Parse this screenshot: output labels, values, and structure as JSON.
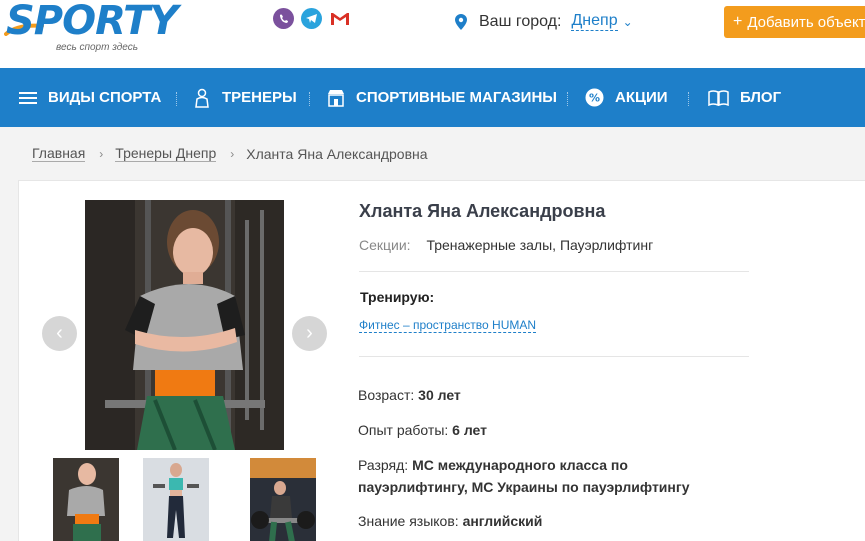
{
  "header": {
    "logo_text": "SPORTY",
    "logo_tagline": "весь спорт здесь",
    "social": [
      {
        "name": "viber-icon"
      },
      {
        "name": "telegram-icon"
      },
      {
        "name": "gmail-icon"
      }
    ],
    "city_label": "Ваш город:",
    "city_value": "Днепр",
    "add_button_label": "Добавить объект"
  },
  "nav": {
    "items": [
      {
        "label": "ВИДЫ СПОРТА",
        "icon": "menu-icon"
      },
      {
        "label": "ТРЕНЕРЫ",
        "icon": "trainer-icon"
      },
      {
        "label": "СПОРТИВНЫЕ МАГАЗИНЫ",
        "icon": "shop-icon"
      },
      {
        "label": "АКЦИИ",
        "icon": "percent-icon"
      },
      {
        "label": "БЛОГ",
        "icon": "book-icon"
      }
    ]
  },
  "breadcrumb": {
    "items": [
      "Главная",
      "Тренеры Днепр"
    ],
    "current": "Хланта Яна Александровна"
  },
  "profile": {
    "name": "Хланта Яна Александровна",
    "sections_label": "Секции:",
    "sections_value": "Тренажерные залы,  Пауэрлифтинг",
    "train_label": "Тренирую:",
    "train_link": "Фитнес – пространство HUMAN",
    "age_label": "Возраст:",
    "age_value": "30 лет",
    "experience_label": "Опыт работы:",
    "experience_value": "6 лет",
    "rank_label": "Разряд:",
    "rank_value_line1": "МС международного класса по",
    "rank_value_line2": "пауэрлифтингу, МС Украины по пауэрлифтингу",
    "languages_label": "Знание языков:",
    "languages_value": "английский"
  },
  "colors": {
    "brand_blue": "#1e7fc9",
    "accent_orange": "#f39c1d"
  }
}
